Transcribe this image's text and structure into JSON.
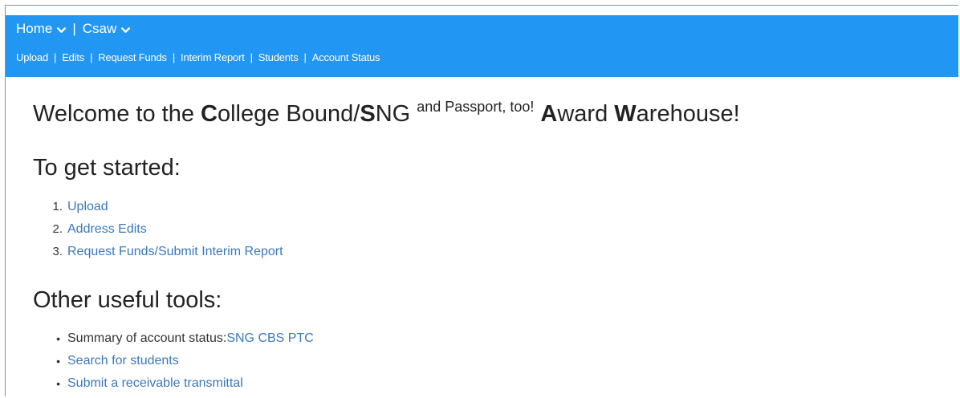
{
  "menu": {
    "home_label": "Home",
    "separator": "|",
    "csaw_label": "Csaw"
  },
  "nav": {
    "items": [
      {
        "label": "Upload"
      },
      {
        "label": "Edits"
      },
      {
        "label": "Request Funds"
      },
      {
        "label": "Interim Report"
      },
      {
        "label": "Students"
      },
      {
        "label": "Account Status"
      }
    ],
    "separator": "|"
  },
  "welcome": {
    "part1": "Welcome to the ",
    "c_bold": "C",
    "part2": "ollege Bound/",
    "s_bold": "S",
    "part3": "NG ",
    "superscript": "and Passport, too!",
    "a_bold": "A",
    "part4": "ward ",
    "w_bold": "W",
    "part5": "arehouse!"
  },
  "get_started": {
    "heading": "To get started:",
    "items": [
      {
        "marker": "1.",
        "label": "Upload"
      },
      {
        "marker": "2.",
        "label": "Address Edits"
      },
      {
        "marker": "3.",
        "label": "Request Funds/Submit Interim Report"
      }
    ]
  },
  "tools": {
    "heading": "Other useful tools:",
    "bullet": "•",
    "summary_prefix": "Summary of account status: ",
    "summary_links": [
      {
        "label": "SNG"
      },
      {
        "label": "CBS"
      },
      {
        "label": "PTC"
      }
    ],
    "search_label": "Search for students",
    "receivable_label": "Submit a receivable transmittal"
  },
  "colors": {
    "topbar": "#2196f3",
    "link": "#3a78bb",
    "text": "#222222"
  }
}
